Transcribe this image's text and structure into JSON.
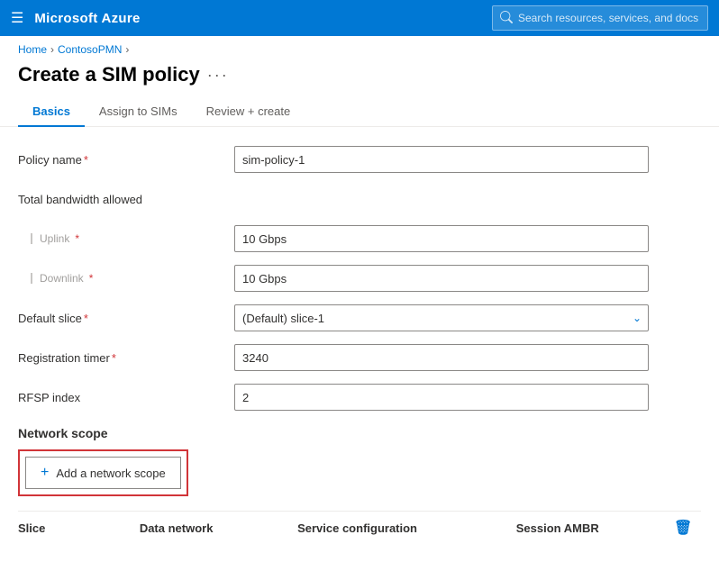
{
  "topbar": {
    "menu_icon": "☰",
    "title": "Microsoft Azure",
    "search_placeholder": "Search resources, services, and docs"
  },
  "breadcrumb": {
    "items": [
      "Home",
      "ContosoPMN"
    ]
  },
  "page": {
    "title": "Create a SIM policy",
    "ellipsis": "···"
  },
  "tabs": [
    {
      "id": "basics",
      "label": "Basics",
      "active": true
    },
    {
      "id": "assign-to-sims",
      "label": "Assign to SIMs",
      "active": false
    },
    {
      "id": "review-create",
      "label": "Review + create",
      "active": false
    }
  ],
  "form": {
    "policy_name_label": "Policy name",
    "policy_name_required": "*",
    "policy_name_value": "sim-policy-1",
    "bandwidth_label": "Total bandwidth allowed",
    "uplink_label": "Uplink",
    "uplink_required": "*",
    "uplink_value": "10 Gbps",
    "downlink_label": "Downlink",
    "downlink_required": "*",
    "downlink_value": "10 Gbps",
    "default_slice_label": "Default slice",
    "default_slice_required": "*",
    "default_slice_value": "(Default) slice-1",
    "registration_timer_label": "Registration timer",
    "registration_timer_required": "*",
    "registration_timer_value": "3240",
    "rfsp_index_label": "RFSP index",
    "rfsp_index_value": "2"
  },
  "network_scope": {
    "section_title": "Network scope",
    "add_button_label": "Add a network scope"
  },
  "table": {
    "columns": [
      {
        "id": "slice",
        "label": "Slice"
      },
      {
        "id": "data-network",
        "label": "Data network"
      },
      {
        "id": "service-configuration",
        "label": "Service configuration"
      },
      {
        "id": "session-ambr",
        "label": "Session AMBR"
      }
    ],
    "delete_icon": "🗑"
  }
}
